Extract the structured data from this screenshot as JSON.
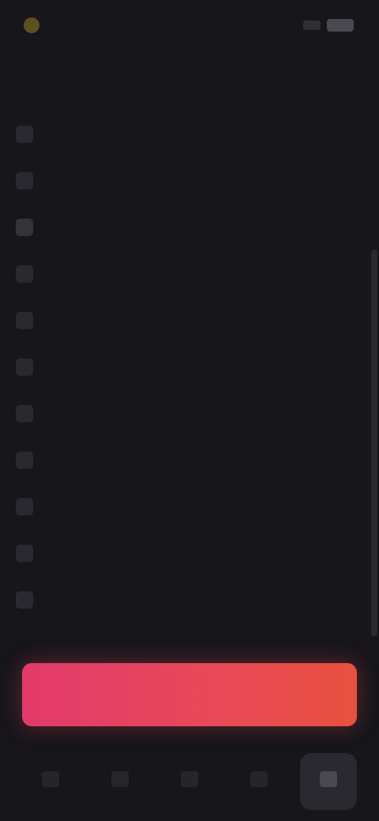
{
  "status_bar": {
    "logo_icon": "brand-logo-icon",
    "signal_icon": "signal-icon",
    "battery_icon": "battery-icon"
  },
  "section": {
    "title": ""
  },
  "menu": {
    "items": [
      {
        "label": "",
        "icon": "item-icon"
      },
      {
        "label": "",
        "icon": "item-icon"
      },
      {
        "label": "",
        "icon": "item-icon"
      },
      {
        "label": "",
        "icon": "item-icon"
      },
      {
        "label": "",
        "icon": "item-icon"
      },
      {
        "label": "",
        "icon": "item-icon"
      },
      {
        "label": "",
        "icon": "item-icon"
      },
      {
        "label": "",
        "icon": "item-icon"
      },
      {
        "label": "",
        "icon": "item-icon"
      },
      {
        "label": "",
        "icon": "item-icon"
      },
      {
        "label": "",
        "icon": "item-icon"
      }
    ]
  },
  "cta": {
    "label": ""
  },
  "bottom_nav": {
    "tabs": [
      {
        "label": "",
        "icon": "tab-icon"
      },
      {
        "label": "",
        "icon": "tab-icon"
      },
      {
        "label": "",
        "icon": "tab-icon"
      },
      {
        "label": "",
        "icon": "tab-icon"
      },
      {
        "label": "",
        "icon": "tab-icon"
      }
    ],
    "active_index": 4
  },
  "colors": {
    "background": "#17161b",
    "cta_gradient_start": "#e23a6b",
    "cta_gradient_end": "#e8503e"
  }
}
